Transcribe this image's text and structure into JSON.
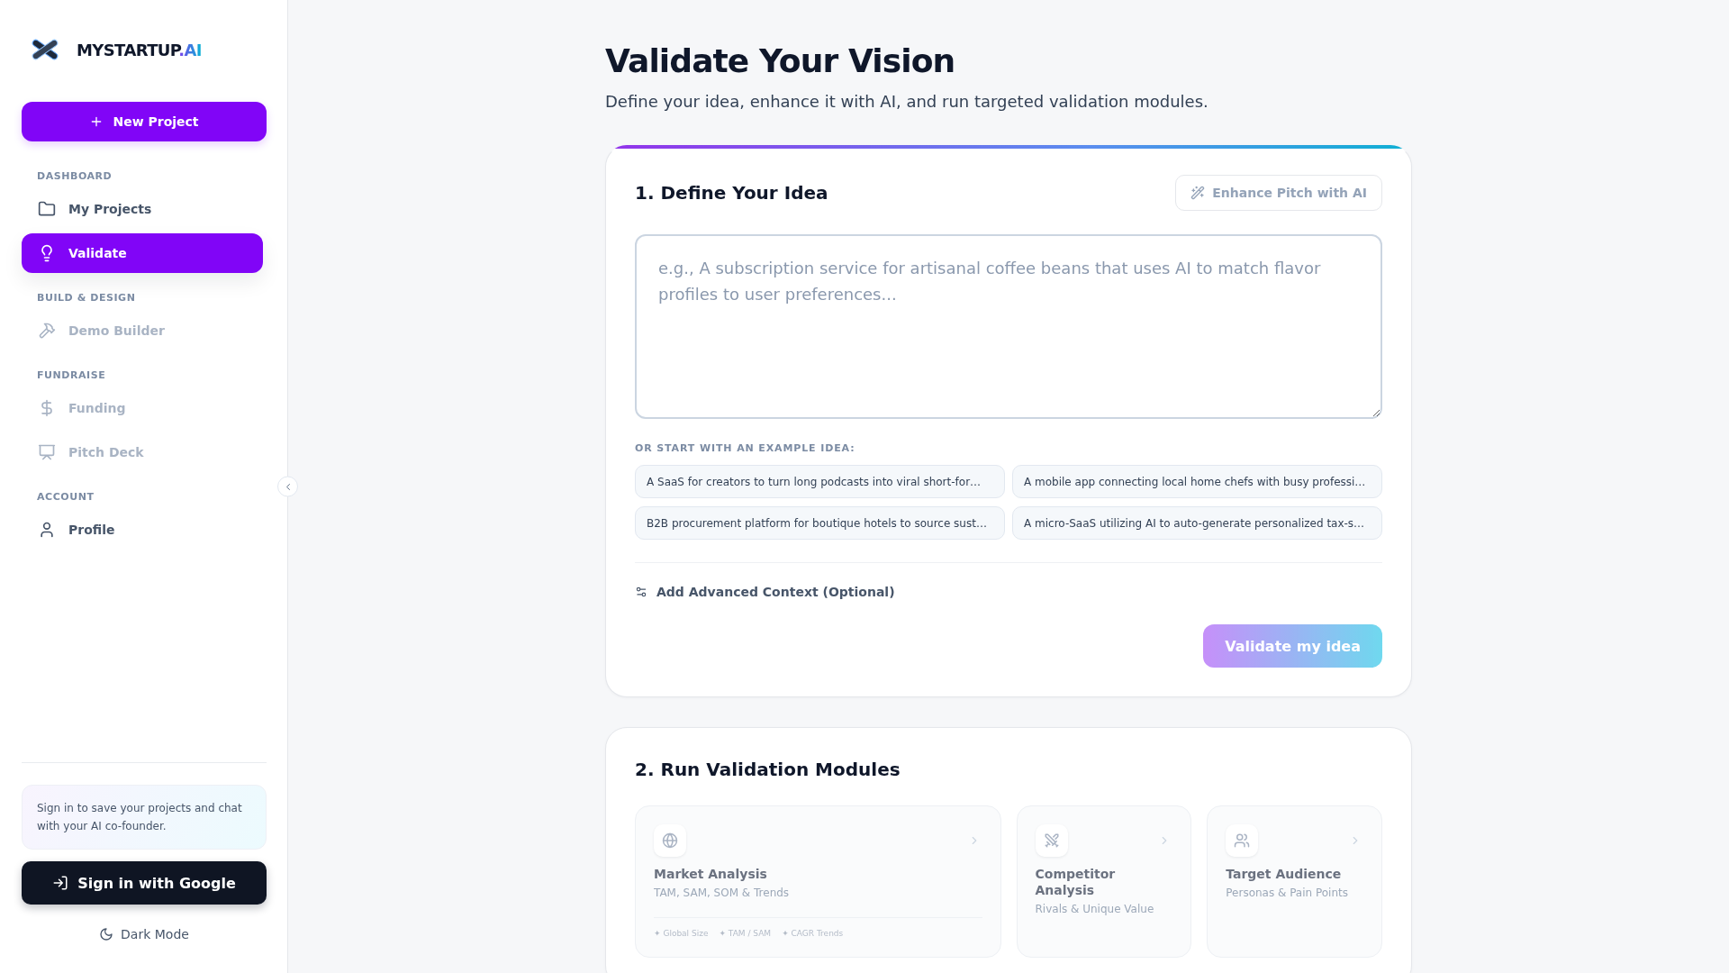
{
  "sidebar": {
    "brand": {
      "name": "MYSTARTUP",
      "suffix": ".AI"
    },
    "new_project_button": {
      "label": "New Project"
    },
    "sections": [
      {
        "heading": "DASHBOARD",
        "items": [
          {
            "label": "My Projects",
            "selected": false,
            "disabled": false
          },
          {
            "label": "Validate",
            "selected": true,
            "disabled": false
          }
        ]
      },
      {
        "heading": "BUILD & DESIGN",
        "items": [
          {
            "label": "Demo Builder",
            "selected": false,
            "disabled": true
          }
        ]
      },
      {
        "heading": "FUNDRAISE",
        "items": [
          {
            "label": "Funding",
            "selected": false,
            "disabled": true
          },
          {
            "label": "Pitch Deck",
            "selected": false,
            "disabled": true
          }
        ]
      },
      {
        "heading": "ACCOUNT",
        "items": [
          {
            "label": "Profile",
            "selected": false,
            "disabled": false
          }
        ]
      }
    ],
    "sign_in_prompt": "Sign in to save your projects and chat with your AI co-founder.",
    "sign_in_button": {
      "label": "Sign in with Google"
    },
    "theme_toggle": {
      "label": "Dark Mode"
    }
  },
  "main": {
    "title": "Validate Your Vision",
    "subtitle": "Define your idea, enhance it with AI, and run targeted validation modules.",
    "define_card": {
      "heading": "1. Define Your Idea",
      "enhance_button": {
        "label": "Enhance Pitch with AI",
        "disabled": true
      },
      "idea_field": {
        "placeholder": "e.g., A subscription service for artisanal coffee beans that uses AI to match flavor profiles to user preferences..."
      },
      "examples_label": "OR START WITH AN EXAMPLE IDEA:",
      "examples": [
        "A SaaS for creators to turn long podcasts into viral short-for…",
        "A mobile app connecting local home chefs with busy professi…",
        "B2B procurement platform for boutique hotels to source sust…",
        "A micro-SaaS utilizing AI to auto-generate personalized tax-s…"
      ],
      "advanced_toggle": {
        "label": "Add Advanced Context (Optional)"
      },
      "submit_button": {
        "label": "Validate my idea",
        "disabled": true
      }
    },
    "modules_card": {
      "heading": "2. Run Validation Modules",
      "modules": [
        {
          "title": "Market Analysis",
          "subtitle": "TAM, SAM, SOM & Trends",
          "tags": [
            "✦ Global Size",
            "✦ TAM / SAM",
            "✦ CAGR Trends"
          ],
          "disabled": true
        },
        {
          "title": "Competitor Analysis",
          "subtitle": "Rivals & Unique Value",
          "disabled": true
        },
        {
          "title": "Target Audience",
          "subtitle": "Personas & Pain Points",
          "disabled": true
        }
      ]
    }
  }
}
